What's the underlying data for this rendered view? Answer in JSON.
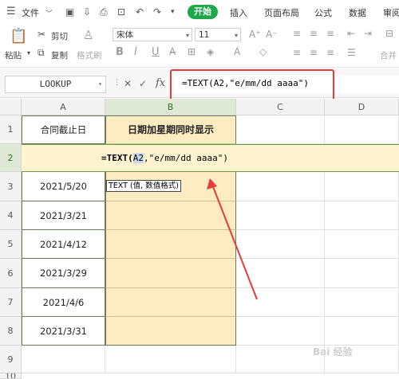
{
  "menu": {
    "menu_icon": "hamburger-menu-icon",
    "file": "文件",
    "tabs": [
      "开始",
      "插入",
      "页面布局",
      "公式",
      "数据",
      "审阅"
    ]
  },
  "ribbon": {
    "paste": "粘贴",
    "cut": "剪切",
    "copy": "复制",
    "format_painter": "格式刷",
    "font_name": "宋体",
    "font_size": "11",
    "merge": "合并"
  },
  "formula_bar": {
    "name_box": "LOOKUP",
    "fx": "fx",
    "cancel": "✕",
    "confirm": "✓",
    "formula": "=TEXT(A2,\"e/mm/dd aaaa\")"
  },
  "sheet": {
    "columns": [
      "A",
      "B",
      "C",
      "D"
    ],
    "rows": [
      "1",
      "2",
      "3",
      "4",
      "5",
      "6",
      "7",
      "8",
      "9",
      "10"
    ],
    "header_a": "合同截止日",
    "header_b": "日期加星期同时显示",
    "edit_formula_prefix": "=TEXT(",
    "edit_formula_ref": "A2",
    "edit_formula_rest": ",\"e/mm/dd aaaa\")",
    "tooltip": "TEXT (值, 数值格式)",
    "dates": [
      "2021/5/20",
      "2021/3/21",
      "2021/4/12",
      "2021/3/29",
      "2021/4/6",
      "2021/3/31"
    ]
  },
  "colors": {
    "accent_green": "#1fa84a",
    "highlight_red": "#e53b3b",
    "cell_fill": "#fdecc1"
  },
  "watermark": "Bai 经验"
}
